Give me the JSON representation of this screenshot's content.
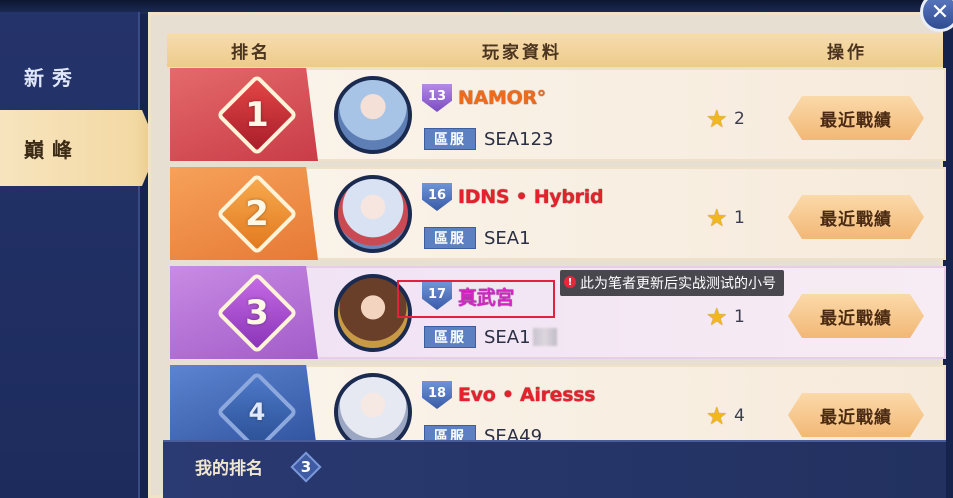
{
  "nav": {
    "items": [
      {
        "label": "新秀",
        "active": false
      },
      {
        "label": "巔峰",
        "active": true
      }
    ]
  },
  "header": {
    "rank": "排名",
    "player_info": "玩家資料",
    "operation": "操作"
  },
  "rows": [
    {
      "rank": "1",
      "level": "13",
      "name": "NAMOR°",
      "server_label": "區服",
      "server": "SEA123",
      "stars": "2",
      "button": "最近戰績",
      "name_color": "#ef6b1c"
    },
    {
      "rank": "2",
      "level": "16",
      "name": "IDNS • Hybrid",
      "server_label": "區服",
      "server": "SEA1",
      "stars": "1",
      "button": "最近戰績",
      "name_color": "#e5212b"
    },
    {
      "rank": "3",
      "level": "17",
      "name": "真武宮",
      "server_label": "區服",
      "server": "SEA1",
      "stars": "1",
      "button": "最近戰績",
      "name_color": "#d326c4"
    },
    {
      "rank": "4",
      "level": "18",
      "name": "Evo • Airesss",
      "server_label": "區服",
      "server": "SEA49",
      "stars": "4",
      "button": "最近戰績",
      "name_color": "#e5212b"
    }
  ],
  "annotation": {
    "text": "此为笔者更新后实战测试的小号",
    "marker": "!"
  },
  "my_rank": {
    "label": "我的排名",
    "value": "3"
  },
  "close": "✕",
  "icons": {
    "star": "★"
  }
}
